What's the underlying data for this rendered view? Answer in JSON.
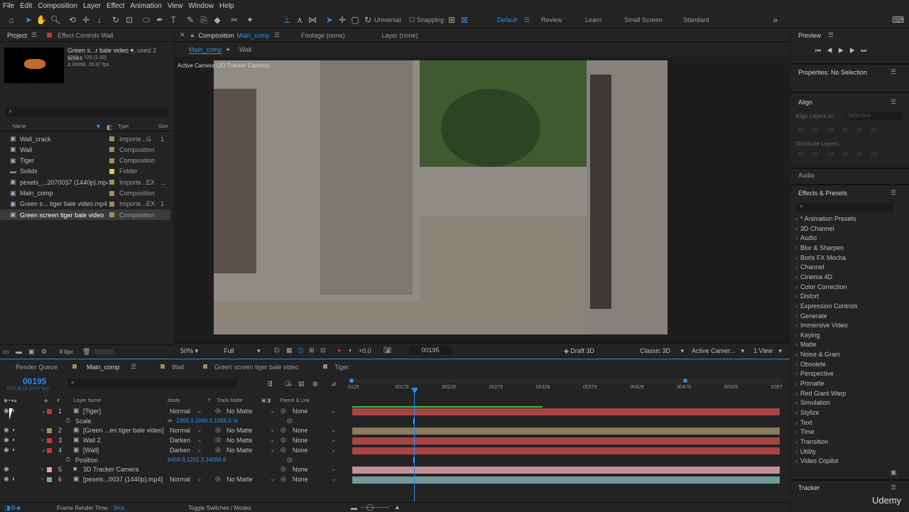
{
  "menu": [
    "File",
    "Edit",
    "Composition",
    "Layer",
    "Effect",
    "Animation",
    "View",
    "Window",
    "Help"
  ],
  "toolbar": {
    "universal": "Universal",
    "snapping": "Snapping",
    "workspaces": [
      "Default",
      "Review",
      "Learn",
      "Small Screen",
      "Standard"
    ]
  },
  "project": {
    "tab": "Project",
    "effect_tab": "Effect Controls Wall",
    "item_name": "Green s...r bale video",
    "used": ", used 2 times",
    "dims": "1280 x 720 (1.00)",
    "dur": "Δ 00999, 29.97 fps",
    "search_placeholder": "⌕",
    "col_name": "Name",
    "col_type": "Type",
    "col_size": "Size",
    "items": [
      {
        "name": "Wall_crack",
        "type": "Importe...G",
        "size": "1",
        "color": "#a58c5c"
      },
      {
        "name": "Wall",
        "type": "Composition",
        "size": "",
        "color": "#a58c5c"
      },
      {
        "name": "Tiger",
        "type": "Composition",
        "size": "",
        "color": "#a58c5c"
      },
      {
        "name": "Solids",
        "type": "Folder",
        "size": "",
        "color": "#e3c83a"
      },
      {
        "name": "pexels_...2070037 (1440p).mp4",
        "type": "Importe...EX",
        "size": "...",
        "color": "#a58c5c"
      },
      {
        "name": "Main_comp",
        "type": "Composition",
        "size": "",
        "color": "#a58c5c"
      },
      {
        "name": "Green s... tiger bale video.mp4",
        "type": "Importe...EX",
        "size": "1",
        "color": "#a58c5c"
      },
      {
        "name": "Green screen tiger bale video",
        "type": "Composition",
        "size": "",
        "color": "#a58c5c"
      }
    ],
    "bpc": "8 bpc"
  },
  "comp": {
    "tab_prefix": "Composition",
    "tab_name": "Main_comp",
    "footage": "Footage (none)",
    "layer": "Layer (none)",
    "crumb1": "Main_comp",
    "crumb2": "Wall",
    "camera_label": "Active Camera (3D Tracker Camera)",
    "zoom": "50%",
    "res": "Full",
    "exposure": "+0.0",
    "frame": "00195",
    "renderer": "Draft 3D",
    "renderer2": "Classic 3D",
    "view": "Active Camer...",
    "views": "1 View"
  },
  "right": {
    "preview": "Preview",
    "properties": "Properties: No Selection",
    "align": "Align",
    "align_to": "Align Layers to:",
    "align_sel": "Selection",
    "distribute": "Distribute Layers:",
    "audio": "Audio",
    "effects": "Effects & Presets",
    "search": "⌕",
    "effects_list": [
      "* Animation Presets",
      "3D Channel",
      "Audio",
      "Blur & Sharpen",
      "Boris FX Mocha",
      "Channel",
      "Cinema 4D",
      "Color Correction",
      "Distort",
      "Expression Controls",
      "Generate",
      "Immersive Video",
      "Keying",
      "Matte",
      "Noise & Grain",
      "Obsolete",
      "Perspective",
      "Primatte",
      "Red Giant Warp",
      "Simulation",
      "Stylize",
      "Text",
      "Time",
      "Transition",
      "Utility",
      "Video Copilot"
    ],
    "tracker": "Tracker",
    "watermark": "Udemy"
  },
  "timeline": {
    "tabs": [
      "Render Queue",
      "Main_comp",
      "Wall",
      "Green screen tiger bale video",
      "Tiger"
    ],
    "timecode": "00195",
    "tc_sub": "0:00:06:15 (29.97 fps)",
    "col_layer": "Layer Name",
    "col_mode": "Mode",
    "col_t": "T",
    "col_matte": "Track Matte",
    "col_parent": "Parent & Link",
    "ruler": [
      "0129",
      "00179",
      "00229",
      "00279",
      "00329",
      "00379",
      "00429",
      "00479",
      "00529",
      "0057"
    ],
    "layers": [
      {
        "num": "1",
        "name": "[Tiger]",
        "mode": "Normal",
        "matte": "No Matte",
        "parent": "None",
        "color": "#c23a3a"
      },
      {
        "num": "",
        "name": "Scale",
        "mode": "",
        "matte": "",
        "parent": "",
        "color": "",
        "value": "1066.0,1066.0,1066.0 %"
      },
      {
        "num": "2",
        "name": "[Green ...en tiger bale video]",
        "mode": "Normal",
        "matte": "No Matte",
        "parent": "None",
        "color": "#a58c5c"
      },
      {
        "num": "3",
        "name": "Wall 2",
        "mode": "Darken",
        "matte": "No Matte",
        "parent": "None",
        "color": "#c23a3a"
      },
      {
        "num": "4",
        "name": "[Wall]",
        "mode": "Darken",
        "matte": "No Matte",
        "parent": "None",
        "color": "#c23a3a"
      },
      {
        "num": "",
        "name": "Position",
        "mode": "",
        "matte": "",
        "parent": "",
        "color": "",
        "value": "6459.9,1202.3,34084.8"
      },
      {
        "num": "5",
        "name": "3D Tracker Camera",
        "mode": "",
        "matte": "",
        "parent": "None",
        "color": "#e3a0b0"
      },
      {
        "num": "6",
        "name": "[pexels...0037 (1440p).mp4]",
        "mode": "Normal",
        "matte": "No Matte",
        "parent": "None",
        "color": "#6fa8a0"
      }
    ],
    "render_time_label": "Frame Render Time:",
    "render_time": "9ms",
    "toggle": "Toggle Switches / Modes"
  }
}
